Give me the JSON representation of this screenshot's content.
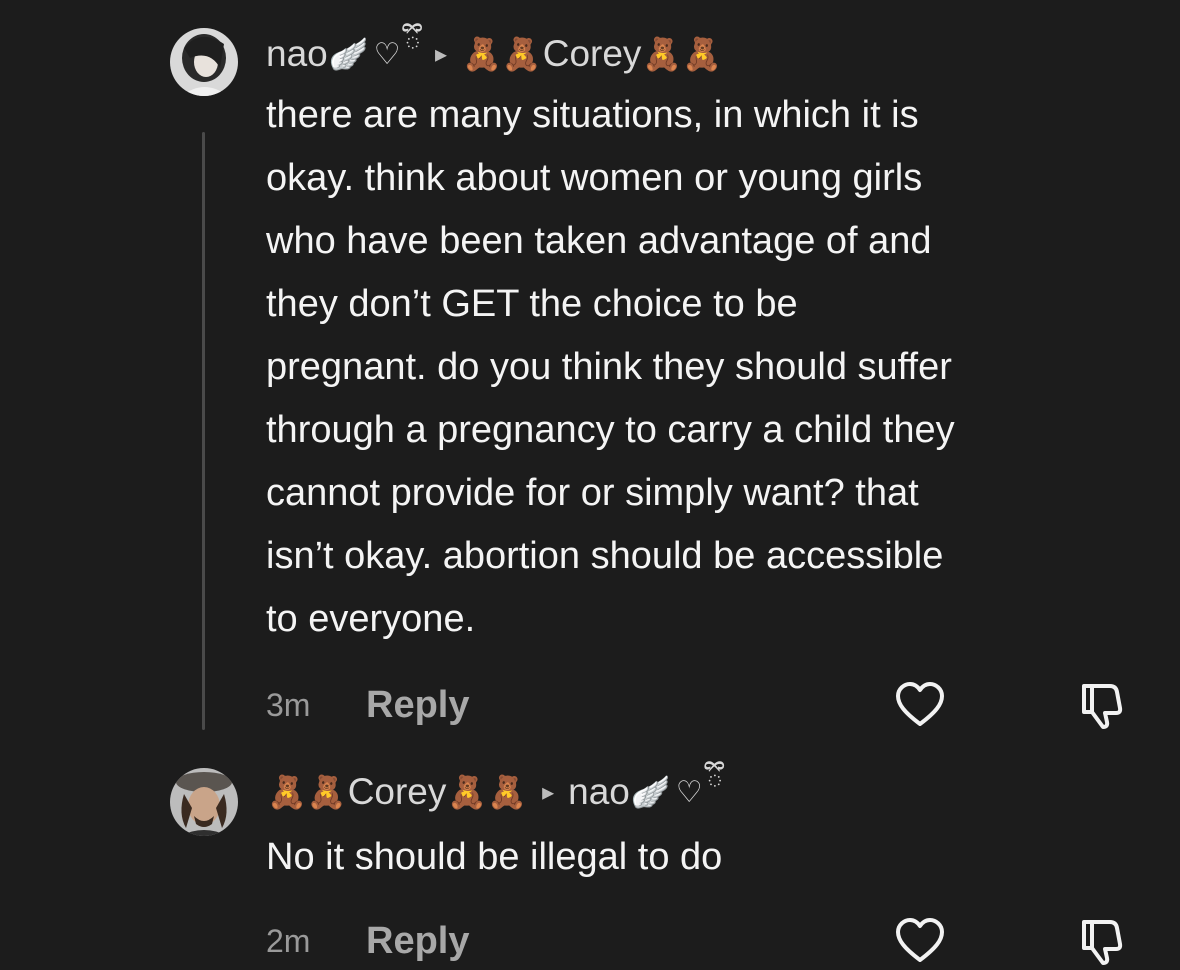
{
  "comments": [
    {
      "author": "nao",
      "author_decor": [
        "🪽",
        "♡",
        "ྀི"
      ],
      "reply_to": "Corey",
      "reply_to_emoji_left": "🧸🧸",
      "reply_to_emoji_right": "🧸🧸",
      "text": "there are many situations, in which it is\nokay. think about women or young girls\nwho have been taken advantage of and\nthey don’t GET the choice to be\npregnant. do you think they should suffer\nthrough a pregnancy to carry a child they\ncannot provide for or simply want? that\nisn’t okay. abortion should be accessible\nto everyone.",
      "time": "3m",
      "reply_label": "Reply"
    },
    {
      "author": "Corey",
      "author_emoji_left": "🧸🧸",
      "author_emoji_right": "🧸🧸",
      "reply_to": "nao",
      "reply_to_decor": [
        "🪽",
        "♡",
        "ྀི"
      ],
      "text": "No it should be illegal to do",
      "time": "2m",
      "reply_label": "Reply"
    }
  ],
  "icons": {
    "like": "heart-icon",
    "dislike": "thumbs-down-icon",
    "separator": "play-arrow-icon"
  },
  "colors": {
    "background": "#1c1c1c",
    "text": "#f4f4f4",
    "muted": "#9a9a9a",
    "thread_line": "#4a4a4a"
  }
}
